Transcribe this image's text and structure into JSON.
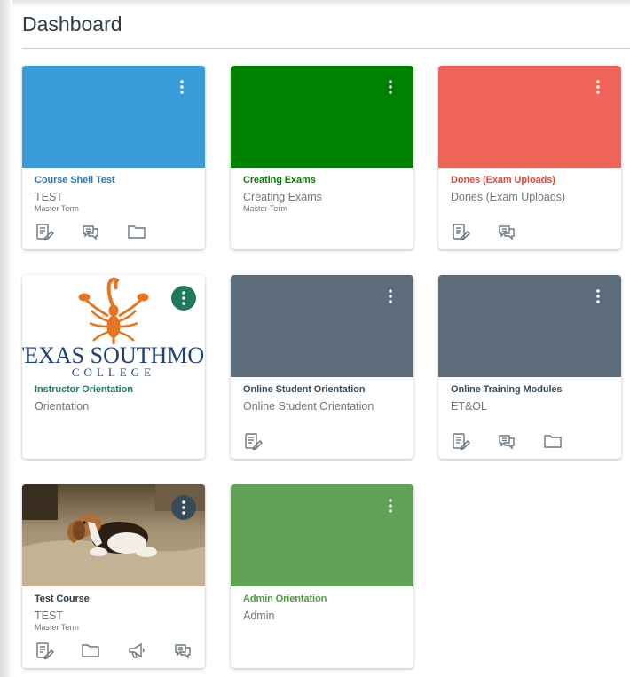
{
  "header": {
    "title": "Dashboard"
  },
  "cards": [
    {
      "name": "Course Shell Test",
      "code": "TEST",
      "term": "Master Term",
      "hero_color": "#3a9bd9",
      "link_color": "#2b7abc",
      "icons": [
        "assignments-icon",
        "discussions-icon",
        "files-icon"
      ]
    },
    {
      "name": "Creating Exams",
      "code": "Creating Exams",
      "term": "Master Term",
      "hero_color": "#008000",
      "link_color": "#0a7a0a",
      "icons": []
    },
    {
      "name": "Dones (Exam Uploads)",
      "code": "Dones (Exam Uploads)",
      "term": "",
      "hero_color": "#ef6459",
      "link_color": "#e3493d",
      "icons": [
        "assignments-icon",
        "discussions-icon"
      ]
    },
    {
      "name": "Instructor Orientation",
      "code": "Orientation",
      "term": "",
      "hero_color": "#ffffff",
      "link_color": "#1f7a5c",
      "icons": [],
      "logo": {
        "line1": "TEXAS SOUTHMOS",
        "line2": "COLLEGE"
      }
    },
    {
      "name": "Online Student Orientation",
      "code": "Online Student Orientation",
      "term": "",
      "hero_color": "#5d6c7b",
      "link_color": "#394b58",
      "icons": [
        "assignments-icon"
      ]
    },
    {
      "name": "Online Training Modules",
      "code": "ET&OL",
      "term": "",
      "hero_color": "#5d6c7b",
      "link_color": "#394b58",
      "icons": [
        "assignments-icon",
        "discussions-icon",
        "files-icon"
      ]
    },
    {
      "name": "Test Course",
      "code": "TEST",
      "term": "Master Term",
      "hero_color": "#8a7a60",
      "link_color": "#2d3b45",
      "icons": [
        "assignments-icon",
        "files-icon",
        "announcements-icon",
        "discussions-icon"
      ]
    },
    {
      "name": "Admin Orientation",
      "code": "Admin",
      "term": "",
      "hero_color": "#62a256",
      "link_color": "#4f9a43",
      "icons": []
    }
  ]
}
